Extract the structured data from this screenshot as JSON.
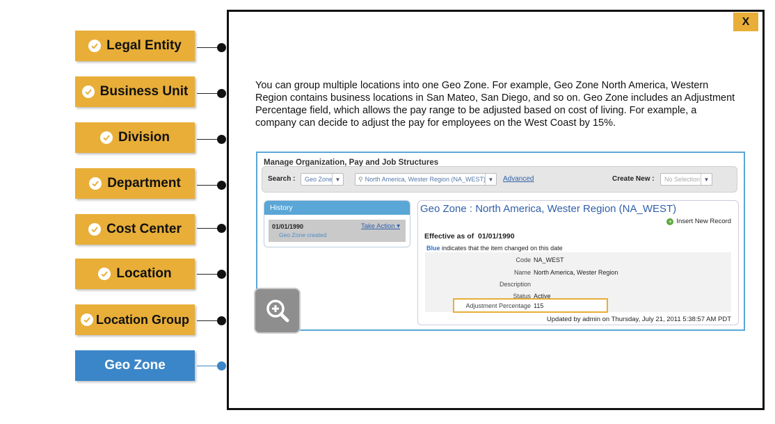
{
  "nav": {
    "items": [
      {
        "label": "Legal Entity"
      },
      {
        "label": "Business Unit"
      },
      {
        "label": "Division"
      },
      {
        "label": "Department"
      },
      {
        "label": "Cost Center"
      },
      {
        "label": "Location"
      },
      {
        "label": "Location Group"
      },
      {
        "label": "Geo Zone",
        "active": true
      }
    ]
  },
  "panel": {
    "close_label": "X",
    "intro": "You can group multiple locations into one Geo Zone. For example, Geo Zone North America, Western Region contains business locations in San Mateo, San Diego, and so on. Geo Zone includes an Adjustment Percentage field, which allows the pay range to be adjusted based on cost of living. For example, a company can decide to adjust the pay for employees on the West Coast by 15%."
  },
  "app": {
    "title": "Manage Organization, Pay and Job Structures",
    "search_label": "Search :",
    "search_type": "Geo Zone",
    "search_value": "North America, Wester Region (NA_WEST)",
    "advanced_link": "Advanced",
    "create_new_label": "Create New :",
    "create_new_value": "No Selection",
    "history": {
      "heading": "History",
      "date": "01/01/1990",
      "action": "Take Action",
      "note": "Geo Zone created"
    },
    "details": {
      "title": "Geo Zone : North America, Wester Region (NA_WEST)",
      "insert_label": "Insert New Record",
      "effective_label": "Effective as of",
      "effective_date": "01/01/1990",
      "blue_word": "Blue",
      "blue_note": "indicates that the item changed on this date",
      "fields": {
        "code_label": "Code",
        "code_value": "NA_WEST",
        "name_label": "Name",
        "name_value": "North America, Wester Region",
        "description_label": "Description",
        "description_value": "",
        "status_label": "Status",
        "status_value": "Active",
        "adjustment_label": "Adjustment Percentage",
        "adjustment_value": "115"
      },
      "updated": "Updated by admin on Thursday, July 21, 2011 5:38:57 AM PDT"
    }
  },
  "colors": {
    "accent": "#e8ae38",
    "active": "#3b86c8",
    "link": "#2f5fa8"
  },
  "icons": {
    "check": "check-circle-icon",
    "zoom": "zoom-in-icon"
  }
}
